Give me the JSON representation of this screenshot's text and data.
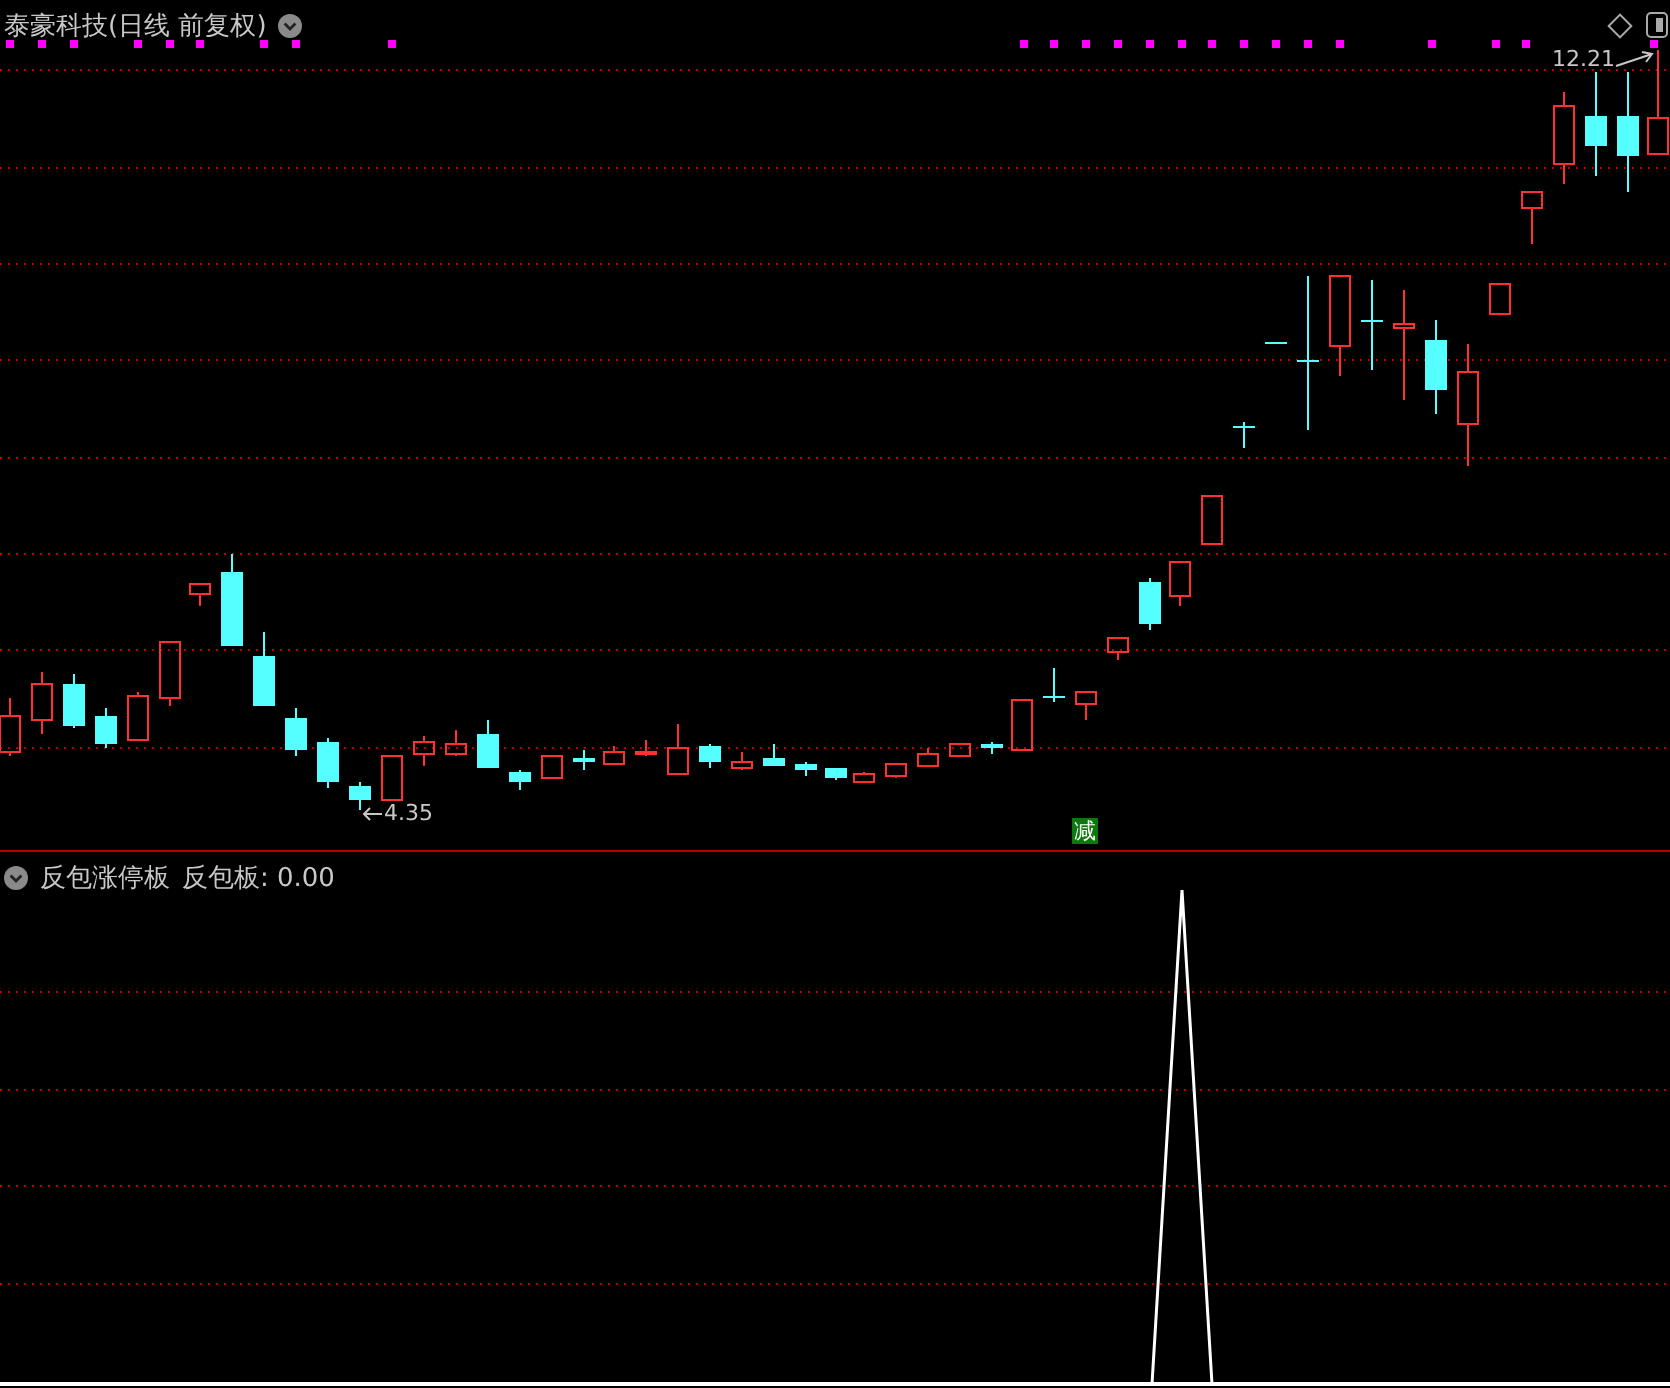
{
  "main_panel": {
    "title": "泰豪科技(日线 前复权)",
    "high_label": "12.21",
    "low_label": "4.35",
    "signal_badge": "减"
  },
  "indicator_panel": {
    "name": "反包涨停板",
    "readout": "反包板: 0.00"
  }
}
